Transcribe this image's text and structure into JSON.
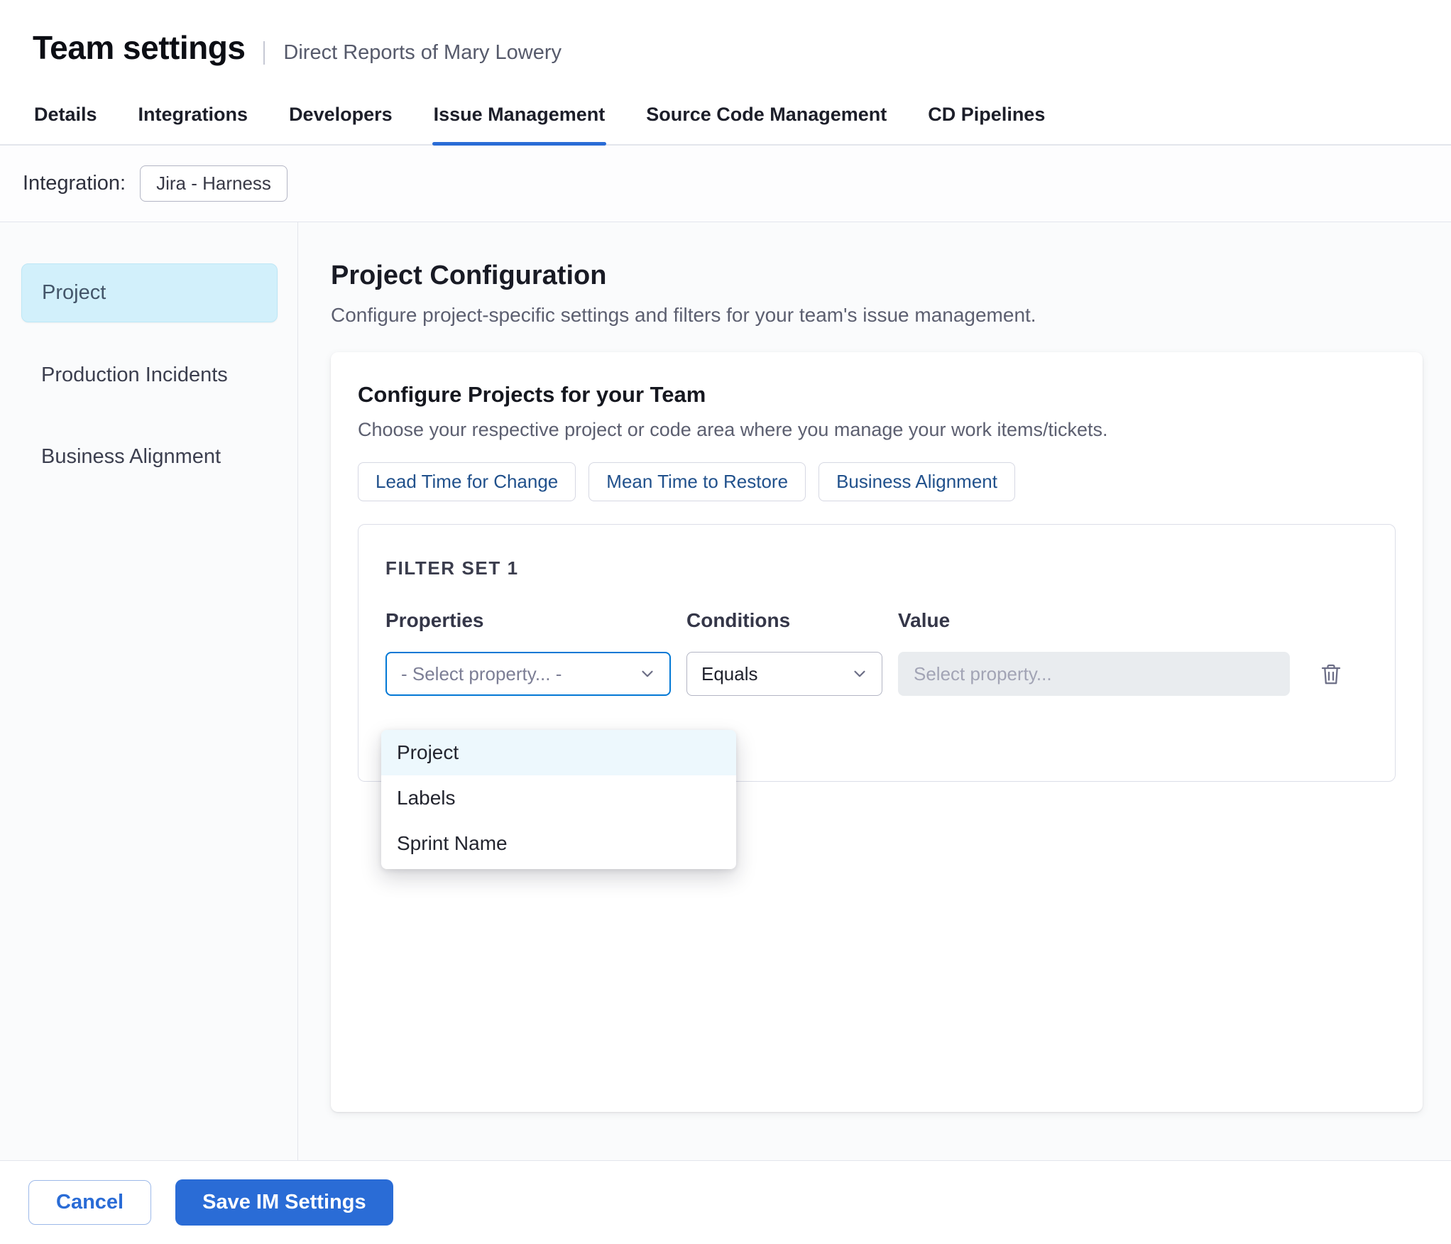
{
  "header": {
    "title": "Team settings",
    "subtitle": "Direct Reports of Mary Lowery"
  },
  "tabs": [
    "Details",
    "Integrations",
    "Developers",
    "Issue Management",
    "Source Code Management",
    "CD Pipelines"
  ],
  "active_tab": "Issue Management",
  "integration": {
    "label": "Integration:",
    "value": "Jira - Harness"
  },
  "sidebar": {
    "items": [
      "Project",
      "Production Incidents",
      "Business Alignment"
    ],
    "active": "Project"
  },
  "main": {
    "title": "Project Configuration",
    "subtitle": "Configure project-specific settings and filters for your team's issue management.",
    "card": {
      "title": "Configure Projects for your Team",
      "subtitle": "Choose your respective project or code area where you manage your work items/tickets.",
      "chips": [
        "Lead Time for Change",
        "Mean Time to Restore",
        "Business Alignment"
      ],
      "filter_set": {
        "title": "FILTER SET 1",
        "columns": {
          "properties": "Properties",
          "conditions": "Conditions",
          "value": "Value"
        },
        "property_placeholder": "- Select property... -",
        "condition_value": "Equals",
        "value_placeholder": "Select property...",
        "options": [
          "Project",
          "Labels",
          "Sprint Name"
        ],
        "highlighted_option": "Project"
      }
    }
  },
  "footer": {
    "cancel_label": "Cancel",
    "save_label": "Save IM Settings"
  },
  "colors": {
    "accent_blue": "#2a6cd6",
    "focus_border": "#0278d5",
    "sidebar_active_bg": "#d2f0fb",
    "chip_text": "#21518c",
    "dropdown_highlight_bg": "#edf8fd",
    "disabled_input_bg": "#e9ecef"
  }
}
